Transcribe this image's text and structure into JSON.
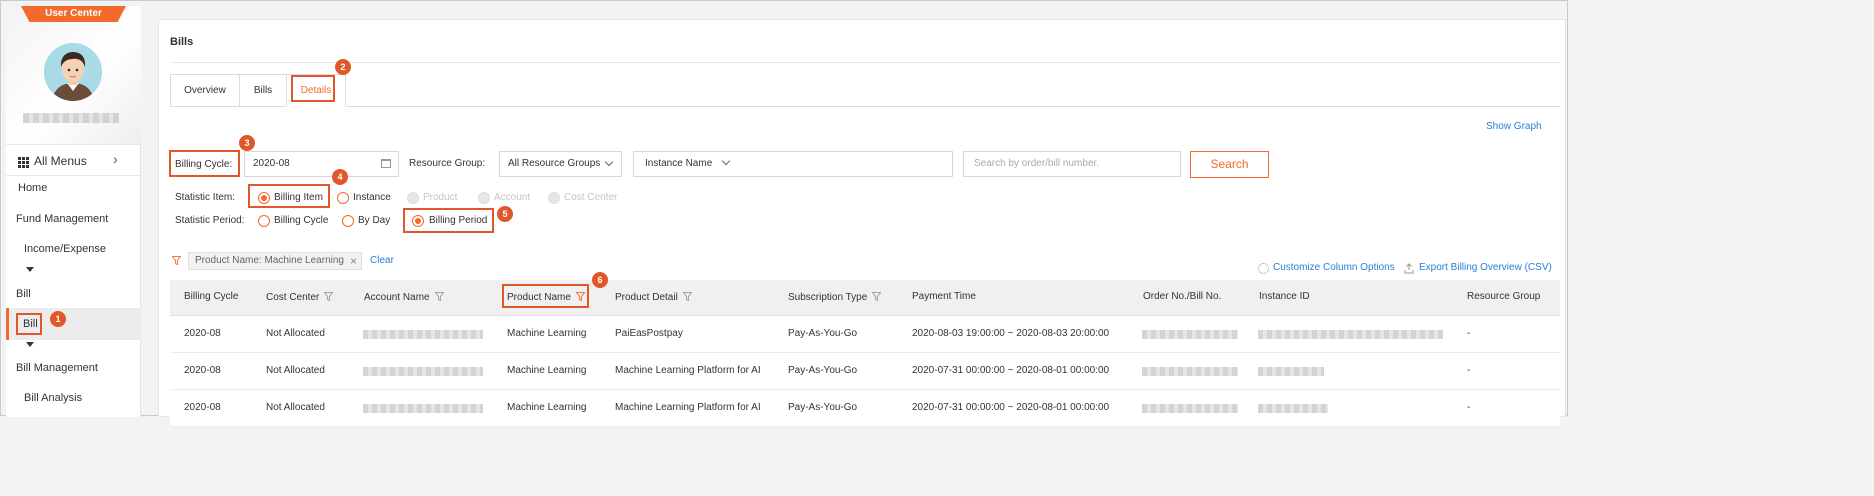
{
  "sidebar": {
    "header_tab": "User Center",
    "all_menus": "All Menus",
    "items": [
      {
        "label": "Home"
      },
      {
        "label": "Fund Management"
      },
      {
        "label": "Income/Expense"
      },
      {
        "label": "Bill"
      },
      {
        "label": "Bill"
      },
      {
        "label": "Bill Management"
      },
      {
        "label": "Bill Analysis"
      }
    ]
  },
  "page": {
    "title": "Bills",
    "tabs": [
      "Overview",
      "Bills",
      "Details"
    ],
    "active_tab": "Details",
    "show_graph": "Show Graph"
  },
  "filters": {
    "billing_cycle_label": "Billing Cycle:",
    "billing_cycle_value": "2020-08",
    "resource_group_label": "Resource Group:",
    "resource_group_value": "All Resource Groups",
    "instance_name_value": "Instance Name",
    "search_placeholder": "Search by order/bill number.",
    "search_button": "Search",
    "statistic_item_label": "Statistic Item:",
    "statistic_item_options": [
      "Billing Item",
      "Instance",
      "Product",
      "Account",
      "Cost Center"
    ],
    "statistic_item_selected": "Billing Item",
    "statistic_period_label": "Statistic Period:",
    "statistic_period_options": [
      "Billing Cycle",
      "By Day",
      "Billing Period"
    ],
    "statistic_period_selected": "Billing Period",
    "active_filter_tag": "Product Name: Machine Learning",
    "clear": "Clear",
    "customize_columns": "Customize Column Options",
    "export": "Export Billing Overview (CSV)"
  },
  "table": {
    "columns": [
      "Billing Cycle",
      "Cost Center",
      "Account Name",
      "Product Name",
      "Product Detail",
      "Subscription Type",
      "Payment Time",
      "Order No./Bill No.",
      "Instance ID",
      "Resource Group"
    ],
    "rows": [
      {
        "billing_cycle": "2020-08",
        "cost_center": "Not Allocated",
        "product_name": "Machine Learning",
        "product_detail": "PaiEasPostpay",
        "subscription_type": "Pay-As-You-Go",
        "payment_time": "2020-08-03 19:00:00  ~  2020-08-03 20:00:00",
        "resource_group": "-"
      },
      {
        "billing_cycle": "2020-08",
        "cost_center": "Not Allocated",
        "product_name": "Machine Learning",
        "product_detail": "Machine Learning Platform for AI",
        "subscription_type": "Pay-As-You-Go",
        "payment_time": "2020-07-31 00:00:00  ~  2020-08-01 00:00:00",
        "resource_group": "-"
      },
      {
        "billing_cycle": "2020-08",
        "cost_center": "Not Allocated",
        "product_name": "Machine Learning",
        "product_detail": "Machine Learning Platform for AI",
        "subscription_type": "Pay-As-You-Go",
        "payment_time": "2020-07-31 00:00:00  ~  2020-08-01 00:00:00",
        "resource_group": "-"
      }
    ]
  },
  "callouts": [
    "1",
    "2",
    "3",
    "4",
    "5",
    "6"
  ],
  "colors": {
    "accent": "#f26b2c",
    "callout": "#e0582a",
    "link": "#2a7fd5"
  }
}
